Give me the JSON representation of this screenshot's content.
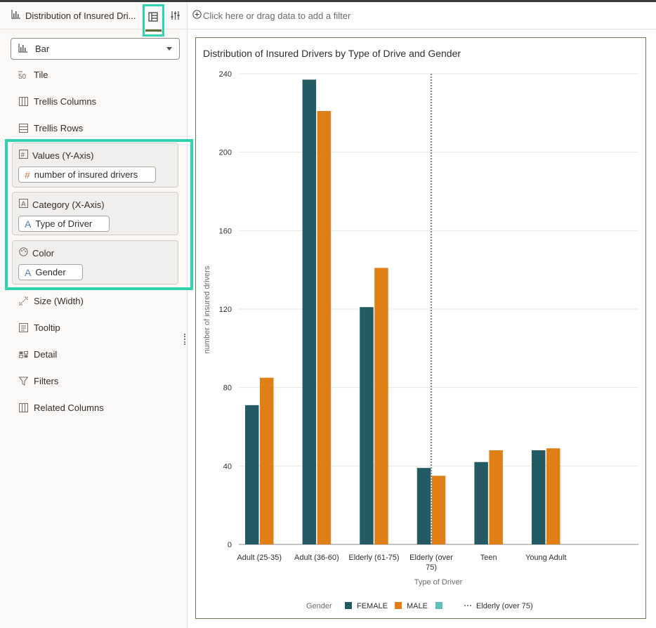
{
  "window": {
    "viz_title": "Distribution of Insured Dri..."
  },
  "left_panel": {
    "viz_type": "Bar",
    "items_top": [
      {
        "label": "Tile",
        "icon": "tile-icon"
      },
      {
        "label": "Trellis Columns",
        "icon": "trellis-columns-icon"
      },
      {
        "label": "Trellis Rows",
        "icon": "trellis-rows-icon"
      }
    ],
    "zones": [
      {
        "title": "Values (Y-Axis)",
        "icon": "hash-grid-icon",
        "pill": "number of insured drivers",
        "pill_icon": "#"
      },
      {
        "title": "Category (X-Axis)",
        "icon": "attribute-icon",
        "pill": "Type of Driver",
        "pill_icon": "A"
      },
      {
        "title": "Color",
        "icon": "palette-icon",
        "pill": "Gender",
        "pill_icon": "A"
      }
    ],
    "items_bottom": [
      {
        "label": "Size (Width)",
        "icon": "size-icon"
      },
      {
        "label": "Tooltip",
        "icon": "tooltip-icon"
      },
      {
        "label": "Detail",
        "icon": "detail-icon"
      },
      {
        "label": "Filters",
        "icon": "filter-icon"
      },
      {
        "label": "Related Columns",
        "icon": "related-columns-icon"
      }
    ]
  },
  "filter_bar": {
    "placeholder": "Click here or drag data to add a filter"
  },
  "colors": {
    "female": "#245a63",
    "male": "#df7f16",
    "extra": "#5cbfbd",
    "accent": "#2fd3b0"
  },
  "chart_data": {
    "type": "bar",
    "title": "Distribution of Insured Drivers by Type of Drive and Gender",
    "xlabel": "Type of Driver",
    "ylabel": "number of insured drivers",
    "ylim": [
      0,
      240
    ],
    "yticks": [
      0,
      40,
      80,
      120,
      160,
      200,
      240
    ],
    "categories": [
      "Adult (25-35)",
      "Adult (36-60)",
      "Elderly (61-75)",
      "Elderly (over 75)",
      "Teen",
      "Young Adult"
    ],
    "category_lines": [
      [
        "Adult (25-35)"
      ],
      [
        "Adult (36-60)"
      ],
      [
        "Elderly (61-75)"
      ],
      [
        "Elderly (over",
        "75)"
      ],
      [
        "Teen"
      ],
      [
        "Young Adult"
      ]
    ],
    "series": [
      {
        "name": "FEMALE",
        "values": [
          71,
          237,
          121,
          39,
          42,
          48
        ]
      },
      {
        "name": "MALE",
        "values": [
          85,
          221,
          141,
          35,
          48,
          49
        ]
      }
    ],
    "reference_line": {
      "label": "Elderly (over 75)",
      "category": "Elderly (over 75)"
    },
    "legend": {
      "title": "Gender",
      "position": "bottom"
    },
    "grid": true
  }
}
